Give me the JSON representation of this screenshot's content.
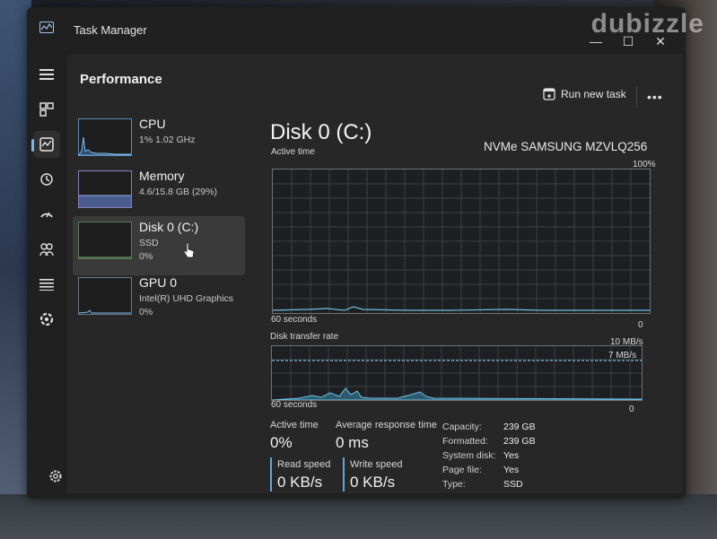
{
  "watermark": "dubizzle",
  "window": {
    "title": "Task Manager",
    "minimize": "—",
    "maximize": "☐",
    "close": "✕"
  },
  "nav": {
    "icons": [
      "menu-icon",
      "processes-icon",
      "performance-icon",
      "app-history-icon",
      "startup-apps-icon",
      "users-icon",
      "details-icon",
      "services-icon",
      "settings-icon"
    ]
  },
  "header": {
    "page_title": "Performance",
    "run_new_task": "Run new task",
    "more": "•••"
  },
  "sidebar": {
    "items": [
      {
        "name": "CPU",
        "line1": "1% 1.02 GHz",
        "line2": ""
      },
      {
        "name": "Memory",
        "line1": "4.6/15.8 GB (29%)",
        "line2": ""
      },
      {
        "name": "Disk 0 (C:)",
        "line1": "SSD",
        "line2": "0%"
      },
      {
        "name": "GPU 0",
        "line1": "Intel(R) UHD Graphics",
        "line2": "0%"
      }
    ]
  },
  "detail": {
    "title": "Disk 0 (C:)",
    "model": "NVMe SAMSUNG MZVLQ256",
    "active_time_chart": {
      "label": "Active time",
      "max": "100%",
      "time": "60 seconds",
      "min": "0"
    },
    "transfer_chart": {
      "label": "Disk transfer rate",
      "max": "10 MB/s",
      "mid": "7 MB/s",
      "time": "60 seconds",
      "min": "0"
    },
    "stats": {
      "active_time_label": "Active time",
      "active_time_value": "0%",
      "avg_response_label": "Average response time",
      "avg_response_value": "0 ms",
      "read_label": "Read speed",
      "read_value": "0 KB/s",
      "write_label": "Write speed",
      "write_value": "0 KB/s"
    },
    "properties": [
      {
        "key": "Capacity:",
        "value": "239 GB"
      },
      {
        "key": "Formatted:",
        "value": "239 GB"
      },
      {
        "key": "System disk:",
        "value": "Yes"
      },
      {
        "key": "Page file:",
        "value": "Yes"
      },
      {
        "key": "Type:",
        "value": "SSD"
      }
    ]
  },
  "colors": {
    "accent": "#7ab8e8",
    "graph_line": "#6fc1e6",
    "window_bg": "#202020"
  }
}
